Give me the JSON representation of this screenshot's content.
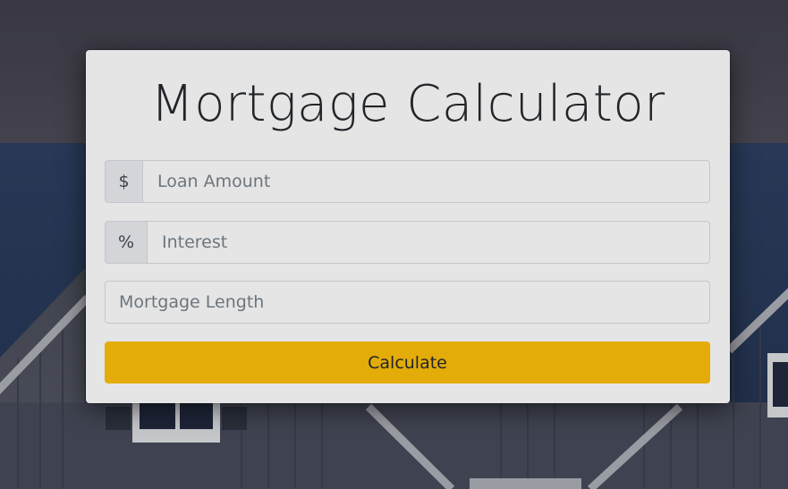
{
  "page": {
    "title": "Mortgage Calculator"
  },
  "form": {
    "loan": {
      "addon": "$",
      "placeholder": "Loan Amount",
      "value": ""
    },
    "interest": {
      "addon": "%",
      "placeholder": "Interest",
      "value": ""
    },
    "length": {
      "placeholder": "Mortgage Length",
      "value": ""
    },
    "submit_label": "Calculate"
  },
  "colors": {
    "card_background": "#e5e5e5",
    "button_accent": "#e3ac08",
    "addon_background": "#d3d5d8",
    "title_text": "#212529",
    "background_roof": "#2b3a55",
    "background_wall": "#454856"
  },
  "background": {
    "icon": "house-facade-photo"
  }
}
